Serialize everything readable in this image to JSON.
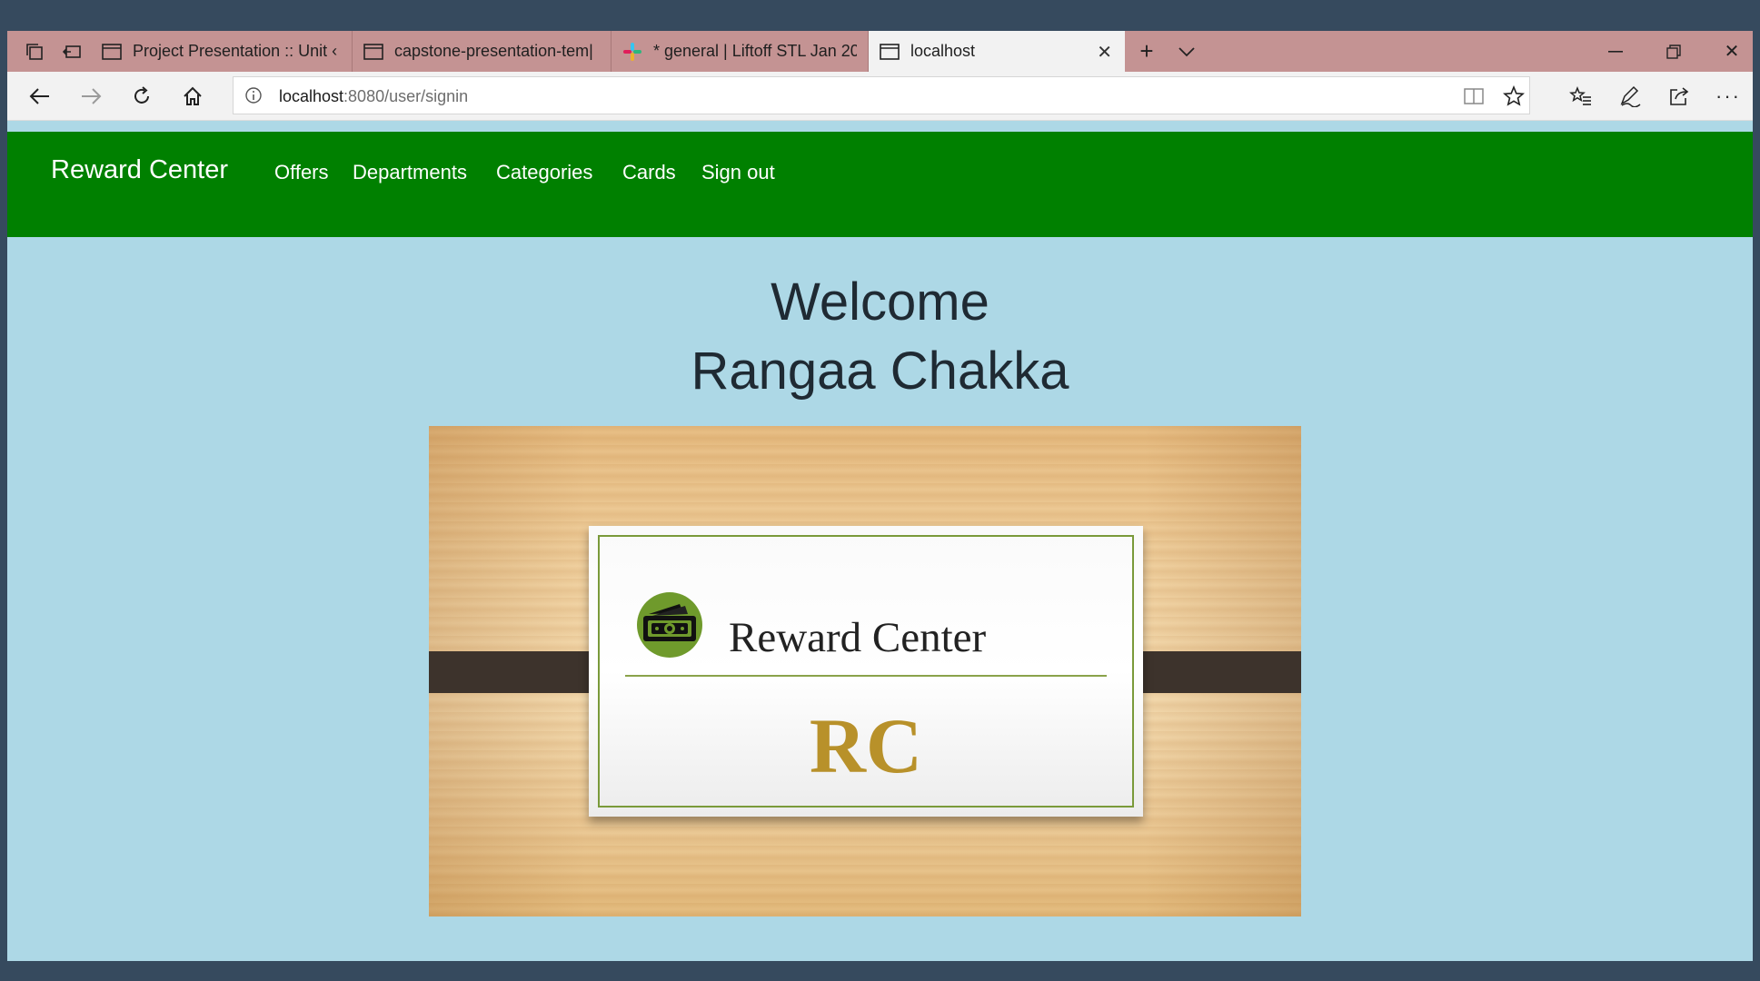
{
  "browser": {
    "tabs": [
      {
        "label": "Project Presentation :: Unit ‹",
        "icon": "page-icon"
      },
      {
        "label": "capstone-presentation-tem|",
        "icon": "page-icon"
      },
      {
        "label": "* general | Liftoff STL Jan 20",
        "icon": "slack-icon"
      },
      {
        "label": "localhost",
        "icon": "page-icon",
        "active": true
      }
    ],
    "address": {
      "host": "localhost",
      "path": ":8080/user/signin"
    }
  },
  "site": {
    "brand": "Reward Center",
    "nav": [
      "Offers",
      "Departments",
      "Categories",
      "Cards",
      "Sign out"
    ],
    "welcome_line1": "Welcome",
    "welcome_line2": "Rangaa Chakka",
    "hero": {
      "title": "Reward Center",
      "monogram": "RC"
    }
  },
  "colors": {
    "header_green": "#008000",
    "page_bg": "#add8e6",
    "tabstrip": "#c49393",
    "monogram_gold": "#b8912a"
  }
}
